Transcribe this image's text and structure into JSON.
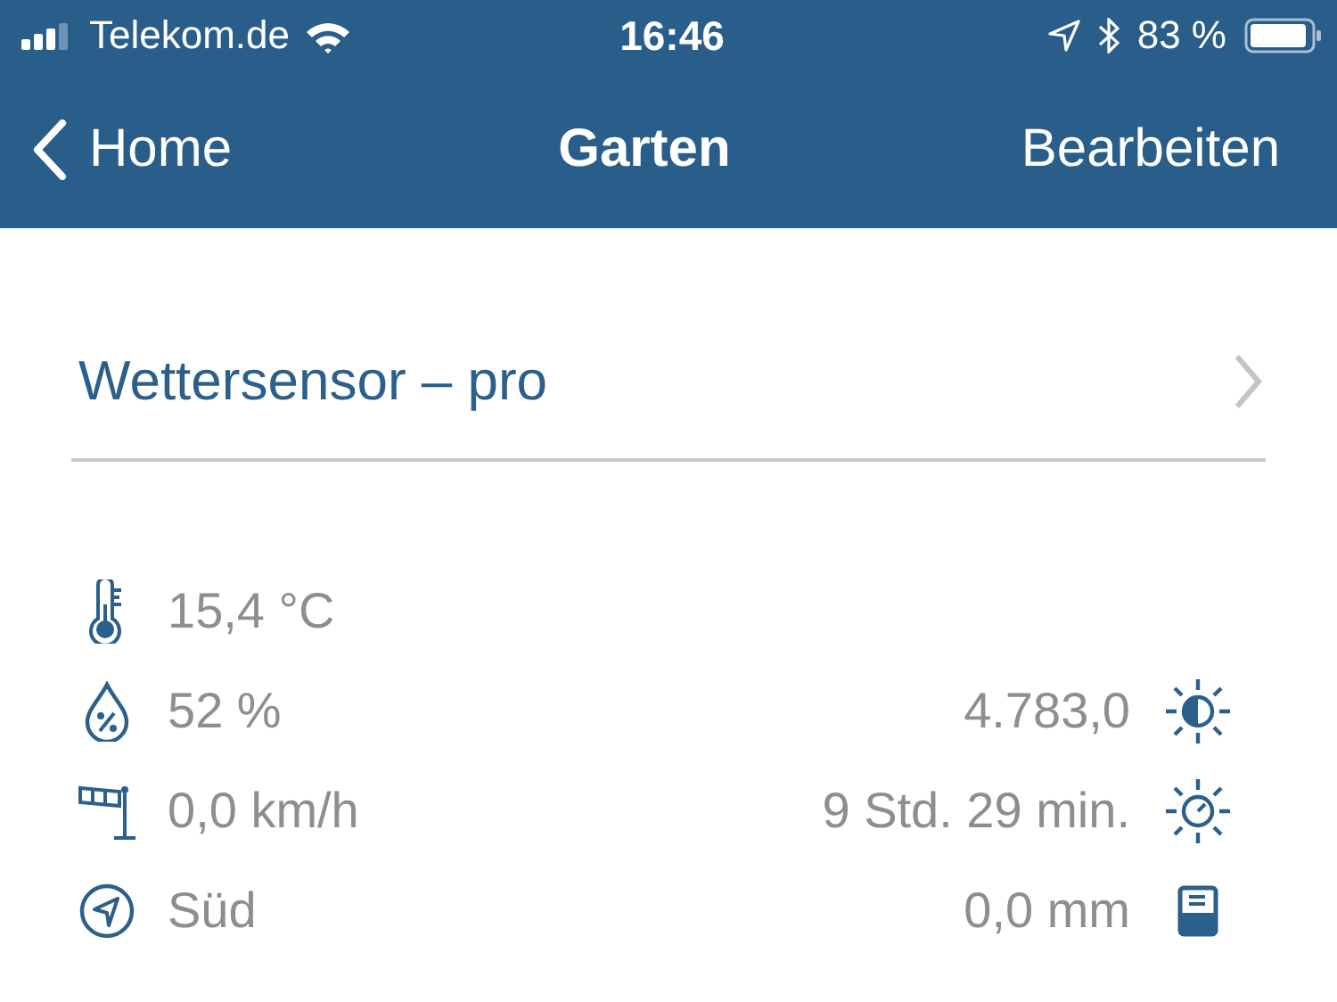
{
  "status_bar": {
    "carrier": "Telekom.de",
    "time": "16:46",
    "battery": "83 %"
  },
  "nav": {
    "back": "Home",
    "title": "Garten",
    "action": "Bearbeiten"
  },
  "device": {
    "name": "Wettersensor – pro"
  },
  "readings": [
    {
      "left": {
        "kind": "temperature",
        "value": "15,4 °C"
      }
    },
    {
      "left": {
        "kind": "humidity",
        "value": "52 %"
      },
      "right": {
        "kind": "brightness",
        "value": "4.783,0"
      }
    },
    {
      "left": {
        "kind": "wind",
        "value": "0,0 km/h"
      },
      "right": {
        "kind": "sunshine",
        "value": "9 Std. 29 min."
      }
    },
    {
      "left": {
        "kind": "direction",
        "value": "Süd"
      },
      "right": {
        "kind": "rain",
        "value": "0,0 mm"
      }
    }
  ]
}
